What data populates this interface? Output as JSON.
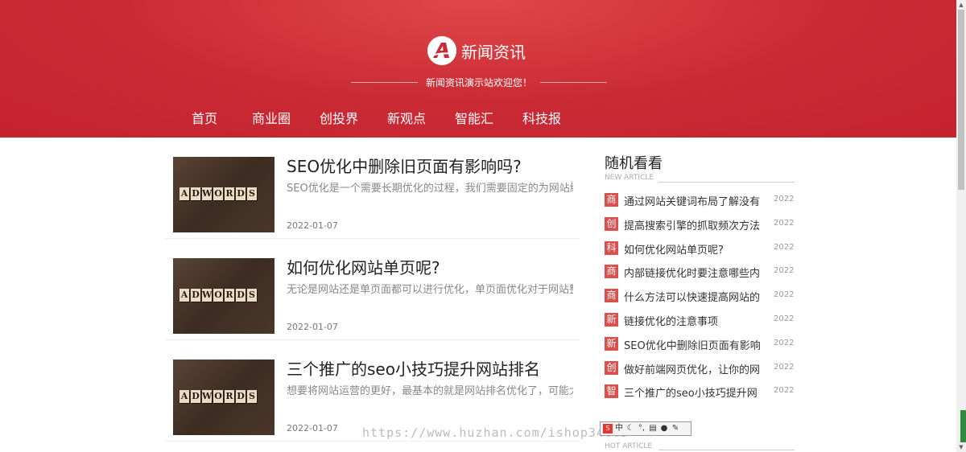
{
  "header": {
    "site_name": "新闻资讯",
    "tagline": "新闻资讯演示站欢迎您！",
    "logo_letter": "A",
    "bg_color": "#c92a34"
  },
  "nav": [
    {
      "label": "首页"
    },
    {
      "label": "商业圈"
    },
    {
      "label": "创投界"
    },
    {
      "label": "新观点"
    },
    {
      "label": "智能汇"
    },
    {
      "label": "科技报"
    }
  ],
  "articles": [
    {
      "title": "SEO优化中删除旧页面有影响吗?",
      "excerpt": "SEO优化是一个需要长期优化的过程，我们需要固定的为网站编",
      "date": "2022-01-07",
      "thumb_text": "ADWORDS"
    },
    {
      "title": "如何优化网站单页呢?",
      "excerpt": "无论是网站还是单页面都可以进行优化，单页面优化对于网站整",
      "date": "2022-01-07",
      "thumb_text": "ADWORDS"
    },
    {
      "title": "三个推广的seo小技巧提升网站排名",
      "excerpt": "想要将网站运营的更好，最基本的就是网站排名优化了，可能大",
      "date": "2022-01-07",
      "thumb_text": "ADWORDS"
    }
  ],
  "sidebar": {
    "random": {
      "title": "随机看看",
      "subtitle": "NEW ARTICLE",
      "items": [
        {
          "cat": "商",
          "text": "通过网站关键词布局了解没有",
          "date": "2022-"
        },
        {
          "cat": "创",
          "text": "提高搜索引擎的抓取频次方法",
          "date": "2022-"
        },
        {
          "cat": "科",
          "text": "如何优化网站单页呢?",
          "date": "2022-"
        },
        {
          "cat": "商",
          "text": "内部链接优化时要注意哪些内",
          "date": "2022-"
        },
        {
          "cat": "商",
          "text": "什么方法可以快速提高网站的",
          "date": "2022-"
        },
        {
          "cat": "新",
          "text": "链接优化的注意事项",
          "date": "2022-"
        },
        {
          "cat": "新",
          "text": "SEO优化中删除旧页面有影响",
          "date": "2022-"
        },
        {
          "cat": "创",
          "text": "做好前端网页优化，让你的网",
          "date": "2022-"
        },
        {
          "cat": "智",
          "text": "三个推广的seo小技巧提升网",
          "date": "2022-"
        }
      ]
    },
    "hot": {
      "subtitle": "HOT ARTICLE"
    }
  },
  "watermark": "https://www.huzhan.com/ishop34665",
  "ime_toolbar": {
    "mode": "中"
  },
  "colors": {
    "accent": "#c92a34",
    "category_badge": "#d9504c"
  }
}
